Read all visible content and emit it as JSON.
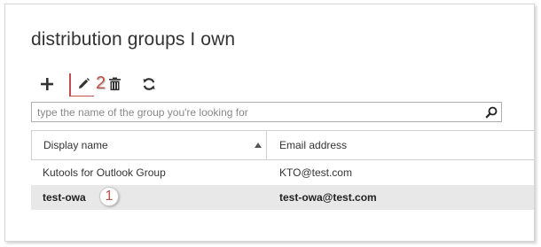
{
  "page": {
    "title": "distribution groups I own"
  },
  "toolbar": {
    "add_icon": "plus-icon",
    "edit_icon": "pencil-icon",
    "delete_icon": "trash-icon",
    "refresh_icon": "refresh-icon",
    "callout_edit": "2"
  },
  "search": {
    "placeholder": "type the name of the group you're looking for",
    "value": "",
    "icon": "search-icon"
  },
  "table": {
    "columns": [
      "Display name",
      "Email address"
    ],
    "rows": [
      {
        "name": "Kutools for Outlook Group",
        "email": "KTO@test.com",
        "selected": false
      },
      {
        "name": "test-owa",
        "email": "test-owa@test.com",
        "selected": true,
        "callout": "1"
      }
    ]
  },
  "colors": {
    "accent": "#c0504d",
    "selected_row": "#e8e8e8",
    "border": "#d0d0d0"
  }
}
